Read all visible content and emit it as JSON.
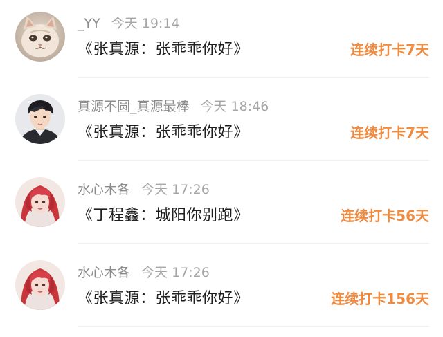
{
  "theme": {
    "accent": "#f08a3e",
    "username_color": "#8c8c8c",
    "time_color": "#a6a6a6",
    "content_color": "#1f1f1f"
  },
  "posts": [
    {
      "username": "_YY",
      "time": "今天 19:14",
      "content": "《张真源：张乖乖你好》",
      "streak": "连续打卡7天",
      "avatar_icon": "cat-avatar-icon"
    },
    {
      "username": "真源不圆_真源最棒",
      "time": "今天 18:46",
      "content": "《张真源：张乖乖你好》",
      "streak": "连续打卡7天",
      "avatar_icon": "boy-portrait-avatar-icon"
    },
    {
      "username": "水心木各",
      "time": "今天 17:26",
      "content": "《丁程鑫：城阳你别跑》",
      "streak": "连续打卡56天",
      "avatar_icon": "red-hair-portrait-avatar-icon"
    },
    {
      "username": "水心木各",
      "time": "今天 17:26",
      "content": "《张真源：张乖乖你好》",
      "streak": "连续打卡156天",
      "avatar_icon": "red-hair-portrait-avatar-icon"
    }
  ]
}
